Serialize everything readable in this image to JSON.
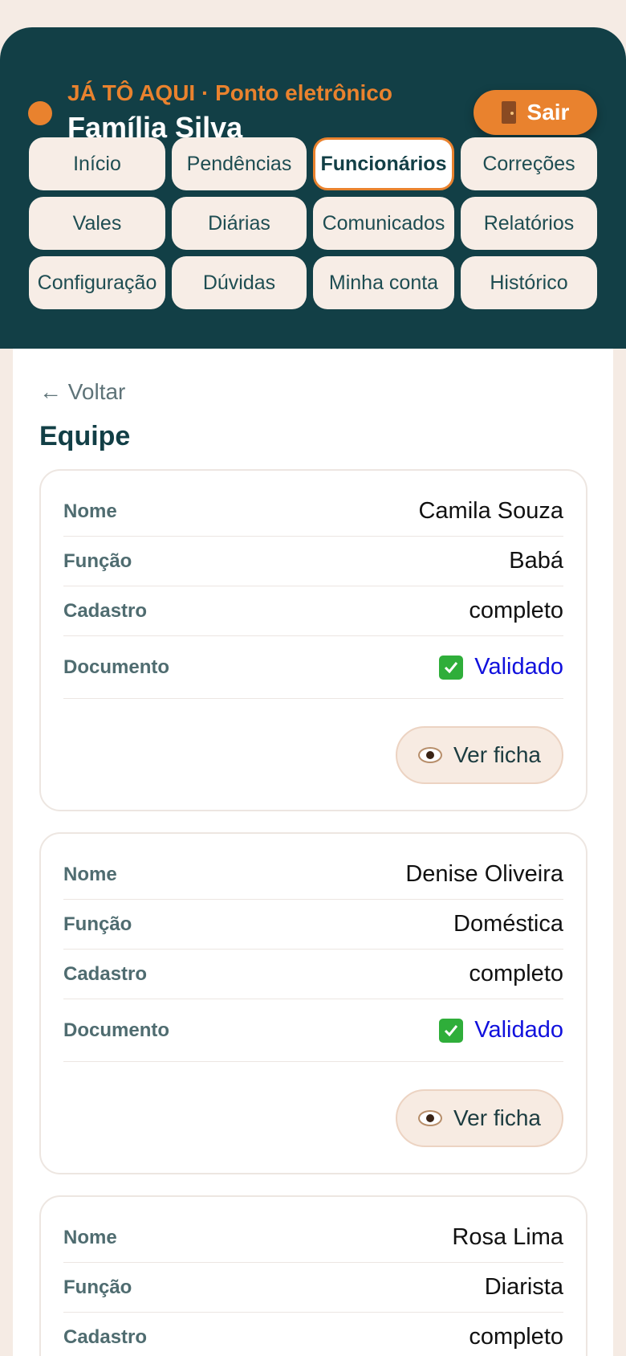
{
  "header": {
    "brand": "JÁ TÔ AQUI · Ponto eletrônico",
    "family": "Família Silva",
    "logout_label": "Sair",
    "logout_icon": "door-icon",
    "accent_color": "#e9822e",
    "header_color": "#123f46"
  },
  "nav": {
    "items": [
      {
        "label": "Início"
      },
      {
        "label": "Pendências"
      },
      {
        "label": "Funcionários",
        "active": true
      },
      {
        "label": "Correções"
      },
      {
        "label": "Vales"
      },
      {
        "label": "Diárias"
      },
      {
        "label": "Comunicados"
      },
      {
        "label": "Relatórios"
      },
      {
        "label": "Configuração"
      },
      {
        "label": "Dúvidas"
      },
      {
        "label": "Minha conta"
      },
      {
        "label": "Histórico"
      }
    ]
  },
  "main": {
    "back_label": "← Voltar",
    "section_title": "Equipe",
    "labels": {
      "name": "Nome",
      "role": "Função",
      "registration": "Cadastro",
      "document": "Documento"
    },
    "view_button_label": "Ver ficha",
    "view_button_icon": "eye-icon",
    "employees": [
      {
        "name": "Camila Souza",
        "role": "Babá",
        "registration": "completo",
        "document": "Validado"
      },
      {
        "name": "Denise Oliveira",
        "role": "Doméstica",
        "registration": "completo",
        "document": "Validado"
      },
      {
        "name": "Rosa Lima",
        "role": "Diarista",
        "registration": "completo"
      }
    ]
  }
}
